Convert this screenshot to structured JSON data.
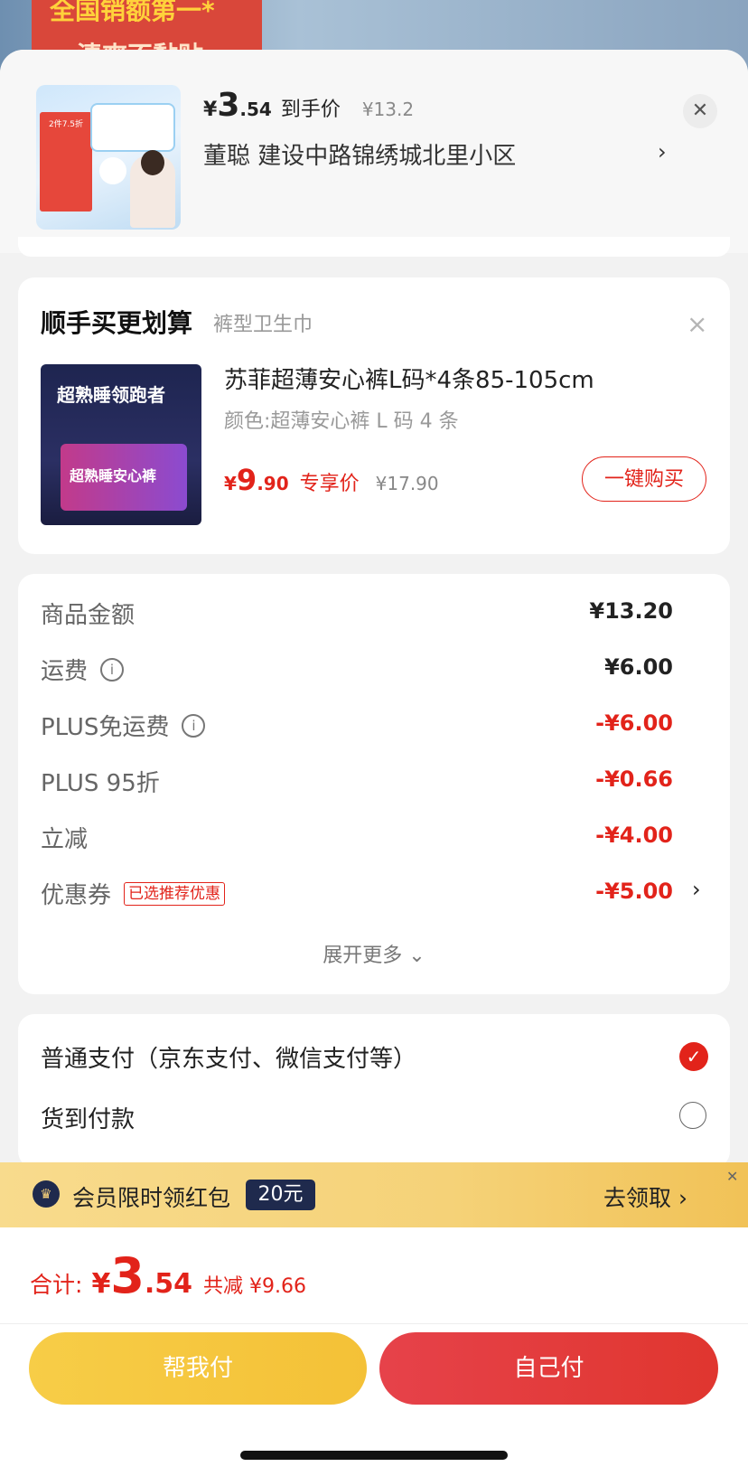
{
  "banner": {
    "line1": "全国销额第一*",
    "line2": "清爽不黏贴"
  },
  "header": {
    "price_yen": "¥",
    "price_int": "3",
    "price_dec": ".54",
    "price_tag": "到手价",
    "original_price": "¥13.2",
    "address": "董聪  建设中路锦绣城北里小区",
    "close_icon": "close-icon"
  },
  "upsell": {
    "title": "顺手买更划算",
    "subtitle": "裤型卫生巾",
    "product_image_text": {
      "headline": "超熟睡领跑者",
      "box_text": "超熟睡安心裤"
    },
    "product_name": "苏菲超薄安心裤L码*4条85-105cm",
    "spec": "颜色:超薄安心裤 L 码 4 条",
    "price_yen": "¥",
    "price_int": "9",
    "price_dec": ".90",
    "price_tag": "专享价",
    "original_price": "¥17.90",
    "buy_button": "一键购买"
  },
  "summary": {
    "rows": [
      {
        "label": "商品金额",
        "value": "¥13.20"
      },
      {
        "label": "运费",
        "value": "¥6.00"
      },
      {
        "label": "PLUS免运费",
        "value": "-¥6.00"
      },
      {
        "label": "PLUS 95折",
        "value": "-¥0.66"
      },
      {
        "label": "立减",
        "value": "-¥4.00"
      },
      {
        "label": "优惠券",
        "tag": "已选推荐优惠",
        "value": "-¥5.00"
      }
    ],
    "expand_more": "展开更多 ⌄"
  },
  "payment": {
    "options": [
      {
        "label": "普通支付（京东支付、微信支付等）",
        "selected": true
      },
      {
        "label": "货到付款",
        "selected": false
      }
    ]
  },
  "promo": {
    "text": "会员限时领红包",
    "badge": "20元",
    "action": "去领取 ›"
  },
  "bottom_bar": {
    "total_label": "合计:",
    "total_yen": "¥",
    "total_int": "3",
    "total_dec": ".54",
    "total_saved": "共减 ¥9.66",
    "help_pay_button": "帮我付",
    "self_pay_button": "自己付"
  },
  "colors": {
    "accent_red": "#e2231a",
    "help_yellow": "#f5c63e",
    "pay_red": "#e23d3d"
  }
}
